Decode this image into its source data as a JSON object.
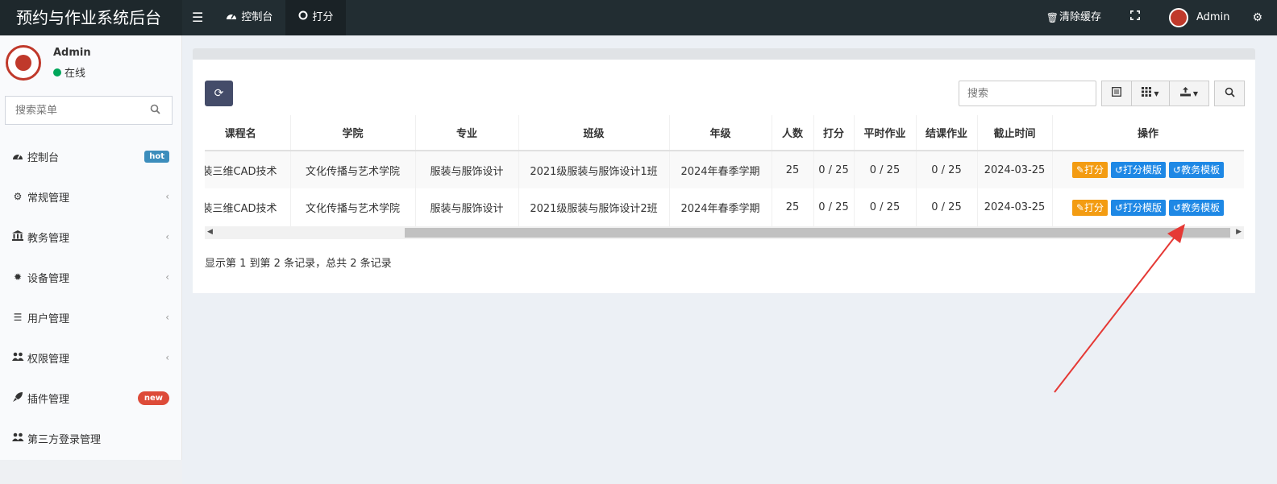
{
  "app": {
    "title": "预约与作业系统后台"
  },
  "header": {
    "tabs": [
      {
        "label": "控制台",
        "icon": "dashboard-icon"
      },
      {
        "label": "打分",
        "icon": "circle-icon"
      }
    ],
    "clear_cache": "清除缓存",
    "user_name": "Admin"
  },
  "sidebar": {
    "user": {
      "name": "Admin",
      "status": "在线"
    },
    "search_placeholder": "搜索菜单",
    "items": [
      {
        "label": "控制台",
        "icon": "dashboard-icon",
        "badge": "hot"
      },
      {
        "label": "常规管理",
        "icon": "cogs-icon"
      },
      {
        "label": "教务管理",
        "icon": "bank-icon"
      },
      {
        "label": "设备管理",
        "icon": "gear-icon"
      },
      {
        "label": "用户管理",
        "icon": "list-icon"
      },
      {
        "label": "权限管理",
        "icon": "users-icon"
      },
      {
        "label": "插件管理",
        "icon": "rocket-icon",
        "badge": "new"
      },
      {
        "label": "第三方登录管理",
        "icon": "users-icon"
      }
    ]
  },
  "toolbar": {
    "search_placeholder": "搜索"
  },
  "table": {
    "columns": [
      "课程名",
      "学院",
      "专业",
      "班级",
      "年级",
      "人数",
      "打分",
      "平时作业",
      "结课作业",
      "截止时间",
      "操作"
    ],
    "rows": [
      [
        "装三维CAD技术",
        "文化传播与艺术学院",
        "服装与服饰设计",
        "2021级服装与服饰设计1班",
        "2024年春季学期",
        "25",
        "0 / 25",
        "0 / 25",
        "0 / 25",
        "2024-03-25"
      ],
      [
        "装三维CAD技术",
        "文化传播与艺术学院",
        "服装与服饰设计",
        "2021级服装与服饰设计2班",
        "2024年春季学期",
        "25",
        "0 / 25",
        "0 / 25",
        "0 / 25",
        "2024-03-25"
      ]
    ],
    "actions": {
      "score": "打分",
      "score_template": "打分模版",
      "edu_template": "教务模板"
    }
  },
  "pagination": {
    "info": "显示第 1 到第 2 条记录，总共 2 条记录"
  },
  "colors": {
    "header_bg": "#222d32",
    "accent": "#1e88e5",
    "warning": "#f39c12",
    "annotation_arrow": "#e53935"
  }
}
